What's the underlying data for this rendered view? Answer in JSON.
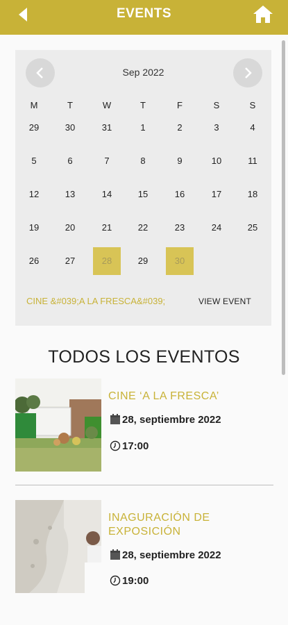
{
  "header": {
    "title": "EVENTS",
    "back_icon": "back-arrow-icon",
    "home_icon": "home-icon",
    "color": "#c8b237"
  },
  "calendar": {
    "month": "Sep 2022",
    "weekdays": [
      "M",
      "T",
      "W",
      "T",
      "F",
      "S",
      "S"
    ],
    "weeks": [
      [
        "29",
        "30",
        "31",
        "1",
        "2",
        "3",
        "4"
      ],
      [
        "5",
        "6",
        "7",
        "8",
        "9",
        "10",
        "11"
      ],
      [
        "12",
        "13",
        "14",
        "15",
        "16",
        "17",
        "18"
      ],
      [
        "19",
        "20",
        "21",
        "22",
        "23",
        "24",
        "25"
      ],
      [
        "26",
        "27",
        "28",
        "29",
        "30",
        "",
        ""
      ]
    ],
    "event_days": [
      "28",
      "30"
    ],
    "event_link": "CINE &#039;A LA FRESCA&#039;",
    "view_event": "VIEW EVENT"
  },
  "section_title": "TODOS LOS EVENTOS",
  "events": [
    {
      "title": "CINE ‘A LA FRESCA’",
      "date": "28, septiembre 2022",
      "time": "17:00"
    },
    {
      "title_line1": "INAGURACIÓN DE",
      "title_line2": "EXPOSICIÓN",
      "date": "28, septiembre 2022",
      "time": "19:00"
    }
  ]
}
